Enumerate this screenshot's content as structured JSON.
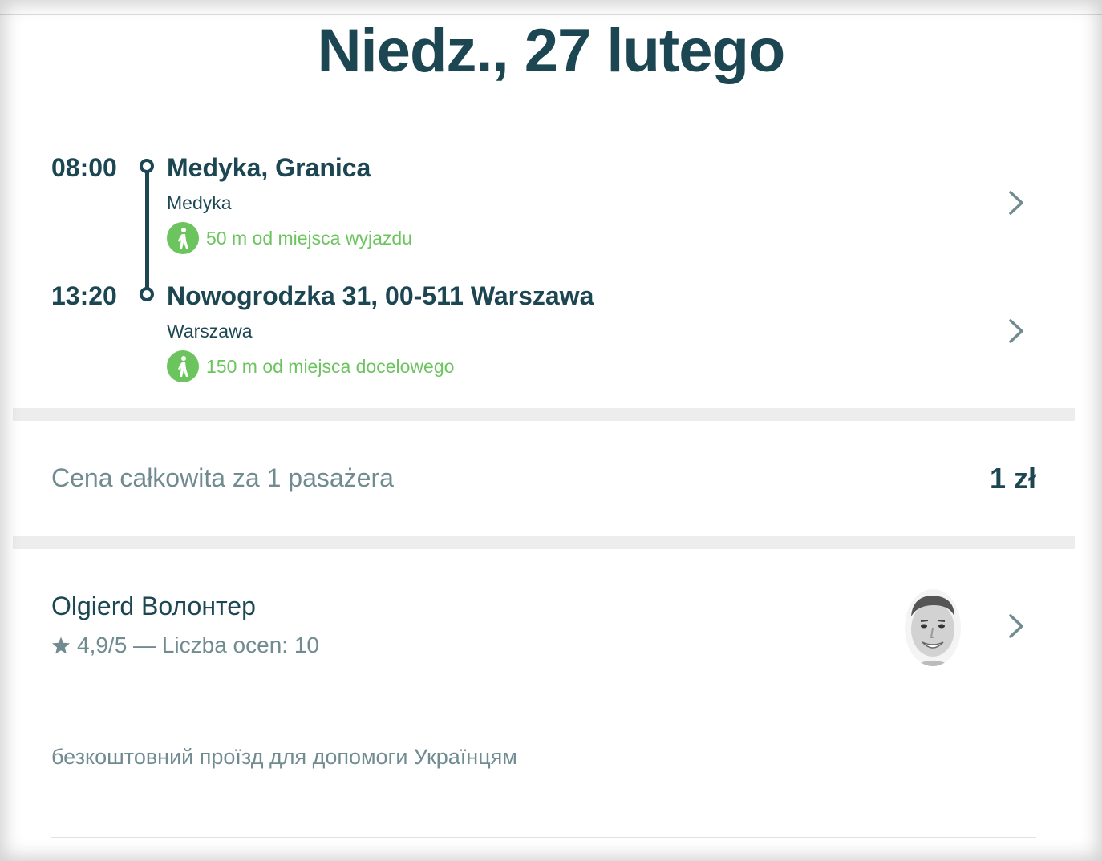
{
  "header": {
    "date": "Niedz., 27 lutego"
  },
  "route": {
    "departure": {
      "time": "08:00",
      "place": "Medyka, Granica",
      "city": "Medyka",
      "walk_distance": "50 m od miejsca wyjazdu"
    },
    "arrival": {
      "time": "13:20",
      "place": "Nowogrodzka 31, 00-511 Warszawa",
      "city": "Warszawa",
      "walk_distance": "150 m od miejsca docelowego"
    }
  },
  "price": {
    "label": "Cena całkowita za 1 pasażera",
    "value": "1 zł"
  },
  "driver": {
    "name": "Olgierd Волонтер",
    "rating": "4,9/5 — Liczba ocen: 10"
  },
  "description": "безкоштовний проїзд для допомоги Українцям",
  "colors": {
    "primary": "#1b4652",
    "secondary": "#708c91",
    "walk_green": "#6cc45e",
    "separator": "#ededed"
  },
  "icons": [
    "pedestrian-icon",
    "chevron-right-icon",
    "star-icon",
    "driver-avatar"
  ]
}
